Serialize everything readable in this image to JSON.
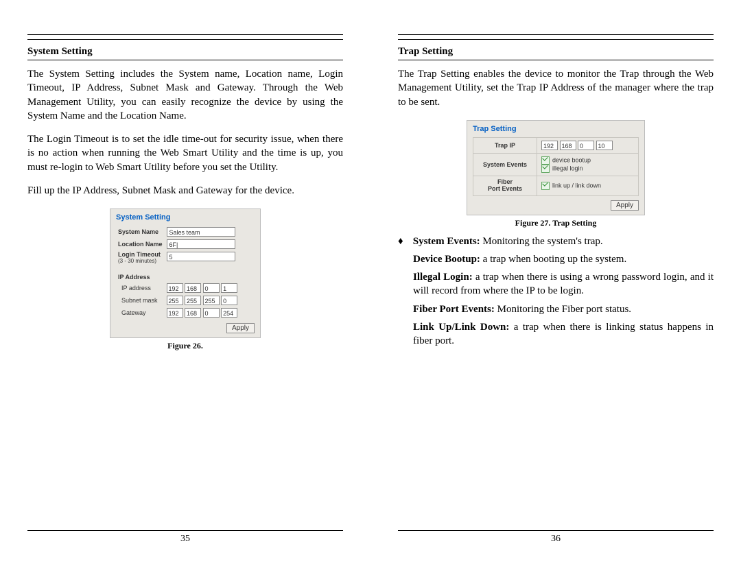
{
  "left": {
    "heading": "System Setting",
    "para1": "The System Setting includes the System name, Location name, Login Timeout, IP Address, Subnet Mask and Gateway. Through the Web Management Utility, you can easily recognize the device by using the System Name and the Location Name.",
    "para2": "The Login Timeout is to set the idle time-out for security issue, when there is no action when running the Web Smart Utility and the time is up, you must re-login to Web Smart Utility before you set the Utility.",
    "para3": "Fill up the IP Address, Subnet Mask and Gateway for the device.",
    "panelTitle": "System Setting",
    "labels": {
      "systemName": "System Name",
      "locationName": "Location Name",
      "loginTimeout": "Login Timeout",
      "loginTimeoutSub": "(3 - 30 minutes)",
      "ipaddress_heading": "IP Address",
      "ipaddress": "IP address",
      "subnet": "Subnet mask",
      "gateway": "Gateway"
    },
    "values": {
      "systemName": "Sales team",
      "locationName": "6F|",
      "loginTimeout": "5",
      "ip": [
        "192",
        "168",
        "0",
        "1"
      ],
      "mask": [
        "255",
        "255",
        "255",
        "0"
      ],
      "gw": [
        "192",
        "168",
        "0",
        "254"
      ]
    },
    "apply": "Apply",
    "figCaption": "Figure 26.",
    "pageNumber": "35"
  },
  "right": {
    "heading": "Trap Setting",
    "para1": "The Trap Setting enables the device to monitor the Trap through the Web Management Utility, set the Trap IP Address of the manager where the trap to be sent.",
    "panelTitle": "Trap Setting",
    "labels": {
      "trapIp": "Trap IP",
      "sysEvents": "System Events",
      "fiberEvents1": "Fiber",
      "fiberEvents2": "Port Events",
      "deviceBootup": "device bootup",
      "illegalLogin": "illegal login",
      "linkUpDown": "link up / link down"
    },
    "values": {
      "trapIp": [
        "192",
        "168",
        "0",
        "10"
      ]
    },
    "apply": "Apply",
    "figCaption": "Figure 27. Trap Setting",
    "bullets": {
      "sysEventsLabel": "System Events:",
      "sysEventsText": " Monitoring the system's trap.",
      "deviceBootupLabel": "Device Bootup:",
      "deviceBootupText": " a trap when booting up the system.",
      "illegalLoginLabel": "Illegal Login:",
      "illegalLoginText": " a trap when there is using a wrong password login, and it will record from where the IP to be login.",
      "fiberPortLabel": "Fiber Port Events:",
      "fiberPortText": " Monitoring the Fiber port status.",
      "linkLabel": "Link Up/Link Down:",
      "linkText": " a trap when there is linking status happens in fiber port."
    },
    "pageNumber": "36"
  },
  "diamond": "♦"
}
